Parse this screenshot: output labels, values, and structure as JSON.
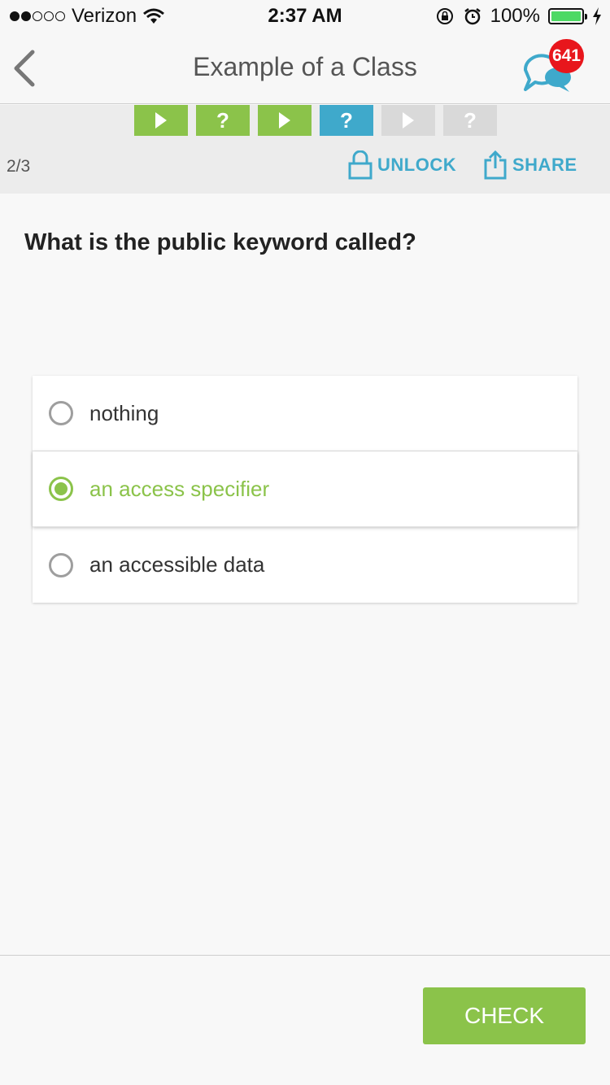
{
  "status_bar": {
    "carrier": "Verizon",
    "time": "2:37 AM",
    "battery": "100%",
    "signal_bars_filled": 2,
    "signal_bars_total": 5
  },
  "nav": {
    "title": "Example of a Class",
    "notification_count": "641"
  },
  "progress": {
    "steps": [
      {
        "type": "play",
        "state": "done",
        "color": "#8bc34a",
        "glyph": "▶"
      },
      {
        "type": "quiz",
        "state": "done",
        "color": "#8bc34a",
        "glyph": "?"
      },
      {
        "type": "play",
        "state": "done",
        "color": "#8bc34a",
        "glyph": "▶"
      },
      {
        "type": "quiz",
        "state": "current",
        "color": "#3fa9cb",
        "glyph": "?"
      },
      {
        "type": "play",
        "state": "locked",
        "color": "#d9d9d9",
        "glyph": "▶"
      },
      {
        "type": "quiz",
        "state": "locked",
        "color": "#d9d9d9",
        "glyph": "?"
      }
    ],
    "counter": "2/3",
    "unlock_label": "UNLOCK",
    "share_label": "SHARE"
  },
  "question": {
    "text": "What is the public keyword called?",
    "options": [
      {
        "label": "nothing",
        "selected": false
      },
      {
        "label": "an access specifier",
        "selected": true
      },
      {
        "label": "an accessible data",
        "selected": false
      }
    ]
  },
  "footer": {
    "check_label": "CHECK"
  },
  "colors": {
    "accent_green": "#8bc34a",
    "accent_blue": "#3fa9cb",
    "badge_red": "#e8161c"
  }
}
